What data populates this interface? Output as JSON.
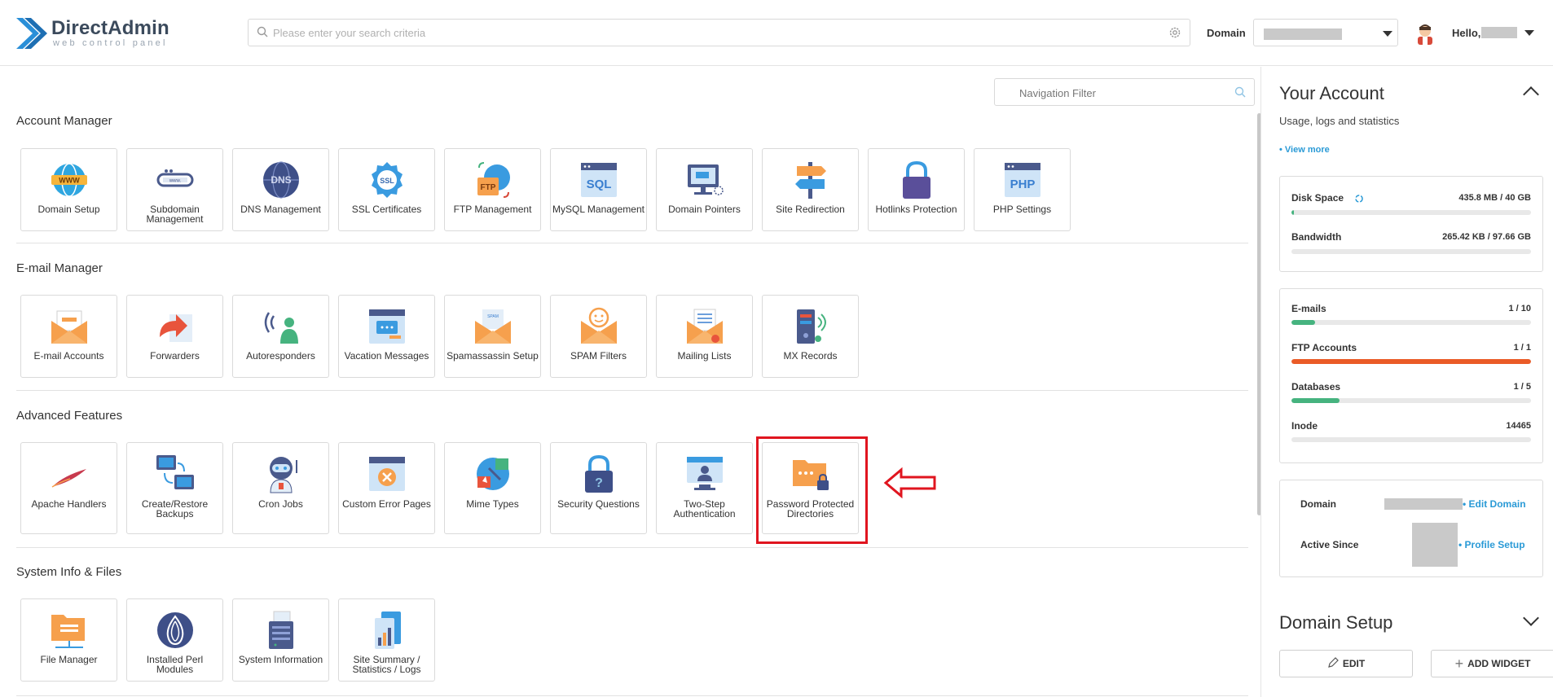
{
  "header": {
    "logo_title": "DirectAdmin",
    "logo_sub": "web control panel",
    "search_placeholder": "Please enter your search criteria",
    "domain_label": "Domain",
    "hello": "Hello,"
  },
  "main": {
    "nav_filter_placeholder": "Navigation Filter",
    "sections": {
      "account": {
        "title": "Account Manager",
        "tiles": [
          "Domain Setup",
          "Subdomain Management",
          "DNS Management",
          "SSL Certificates",
          "FTP Management",
          "MySQL Management",
          "Domain Pointers",
          "Site Redirection",
          "Hotlinks Protection",
          "PHP Settings"
        ]
      },
      "email": {
        "title": "E-mail Manager",
        "tiles": [
          "E-mail Accounts",
          "Forwarders",
          "Autoresponders",
          "Vacation Messages",
          "Spamassassin Setup",
          "SPAM Filters",
          "Mailing Lists",
          "MX Records"
        ]
      },
      "advanced": {
        "title": "Advanced Features",
        "tiles": [
          "Apache Handlers",
          "Create/Restore Backups",
          "Cron Jobs",
          "Custom Error Pages",
          "Mime Types",
          "Security Questions",
          "Two-Step Authentication",
          "Password Protected Directories"
        ]
      },
      "system": {
        "title": "System Info & Files",
        "tiles": [
          "File Manager",
          "Installed Perl Modules",
          "System Information",
          "Site Summary / Statistics / Logs"
        ]
      }
    }
  },
  "account_panel": {
    "title": "Your Account",
    "subtitle": "Usage, logs and statistics",
    "view_more": "• View more",
    "usage": [
      {
        "label": "Disk Space",
        "value": "435.8 MB / 40 GB",
        "fraction": 0.011,
        "color": "#46b37f"
      },
      {
        "label": "Bandwidth",
        "value": "265.42 KB / 97.66 GB",
        "fraction": 0.0,
        "color": "#46b37f"
      }
    ],
    "limits": [
      {
        "label": "E-mails",
        "value": "1 / 10",
        "fraction": 0.1,
        "color": "#46b37f"
      },
      {
        "label": "FTP Accounts",
        "value": "1 / 1",
        "fraction": 1.0,
        "color": "#ea5b27"
      },
      {
        "label": "Databases",
        "value": "1 / 5",
        "fraction": 0.2,
        "color": "#46b37f"
      },
      {
        "label": "Inode",
        "value": "14465",
        "fraction": 0.0,
        "color": "#46b37f"
      }
    ],
    "domain_label": "Domain",
    "edit_domain": "• Edit Domain",
    "active_since_label": "Active Since",
    "profile_setup": "• Profile Setup"
  },
  "domain_setup_panel": {
    "title": "Domain Setup",
    "edit_button": "EDIT",
    "add_widget_button": "ADD WIDGET"
  },
  "colors": {
    "accent": "#2a9ad6",
    "highlight": "#e0151f",
    "ok": "#46b37f",
    "full": "#ea5b27"
  }
}
